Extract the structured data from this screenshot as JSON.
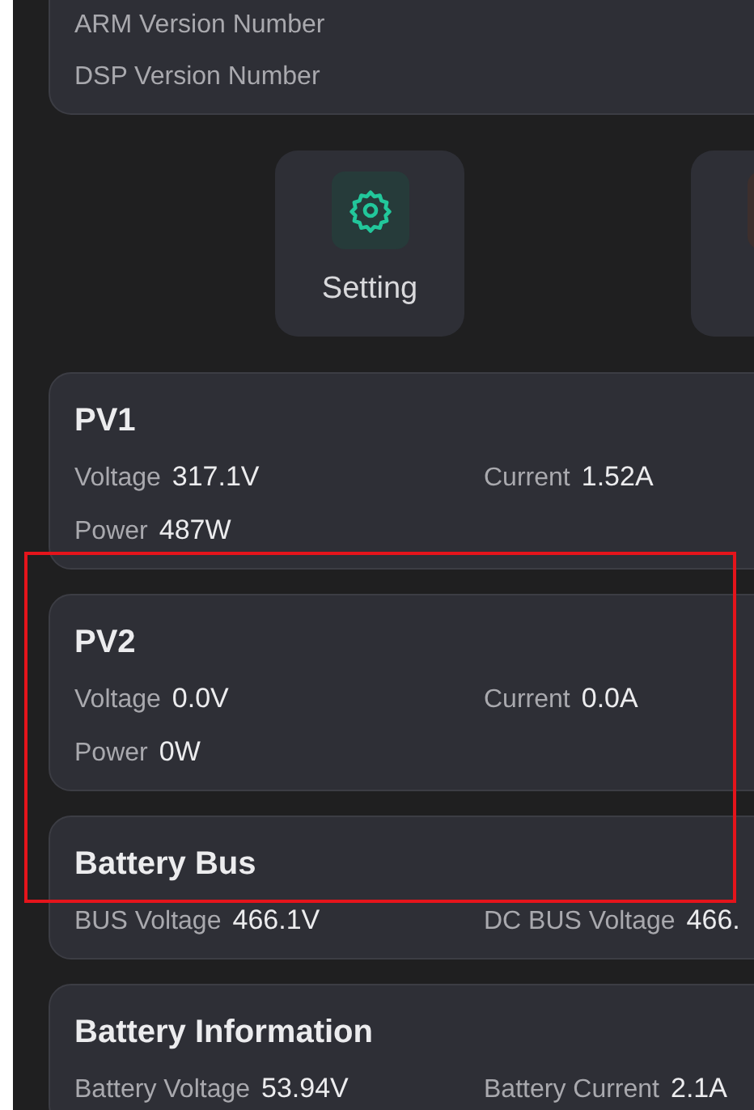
{
  "version_card": {
    "rows": [
      "ARM Version Number",
      "DSP Version Number"
    ]
  },
  "shortcuts": [
    {
      "kind": "setting",
      "label": "Setting"
    },
    {
      "kind": "other"
    }
  ],
  "sections": [
    {
      "title": "PV1",
      "fields": [
        {
          "label": "Voltage",
          "value": "317.1V"
        },
        {
          "label": "Current",
          "value": "1.52A"
        },
        {
          "label": "Power",
          "value": "487W"
        }
      ]
    },
    {
      "title": "PV2",
      "fields": [
        {
          "label": "Voltage",
          "value": "0.0V"
        },
        {
          "label": "Current",
          "value": "0.0A"
        },
        {
          "label": "Power",
          "value": "0W"
        }
      ]
    },
    {
      "title": "Battery Bus",
      "fields": [
        {
          "label": "BUS Voltage",
          "value": "466.1V"
        },
        {
          "label": "DC BUS Voltage",
          "value": "466."
        }
      ]
    },
    {
      "title": "Battery Information",
      "fields": [
        {
          "label": "Battery Voltage",
          "value": "53.94V"
        },
        {
          "label": "Battery Current",
          "value": "2.1A"
        }
      ]
    }
  ]
}
